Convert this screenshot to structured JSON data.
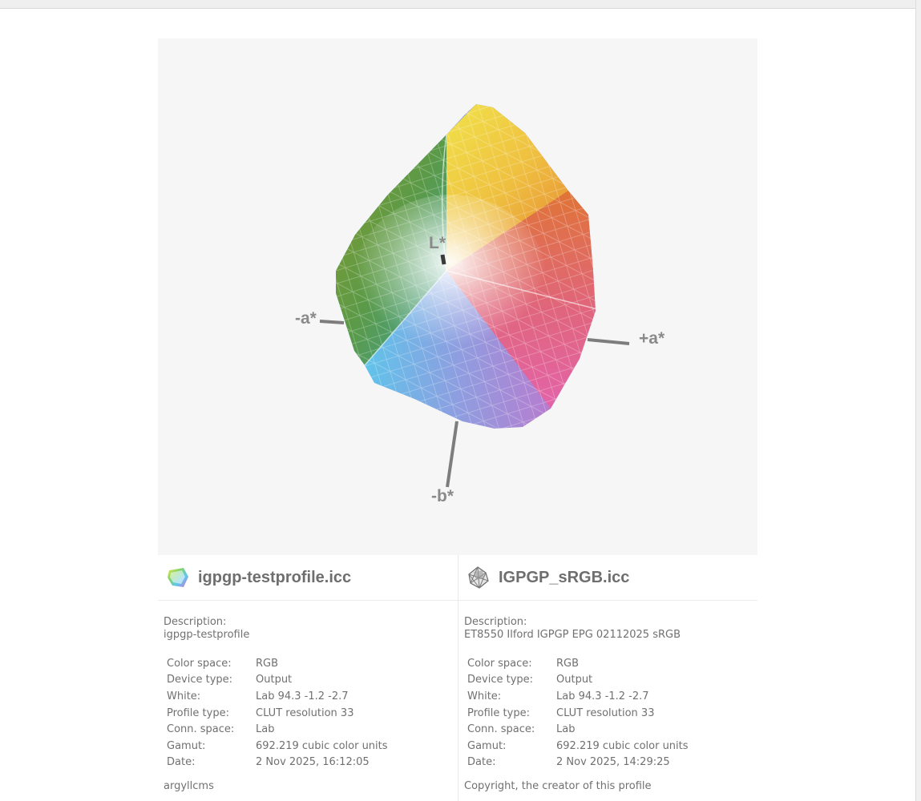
{
  "viewer": {
    "axes": {
      "l_label": "L*",
      "minus_a_label": "-a*",
      "plus_a_label": "+a*",
      "minus_b_label": "-b*"
    }
  },
  "profiles": [
    {
      "title": "igpgp-testprofile.icc",
      "icon": "gamut-cube-icon",
      "description_label": "Description:",
      "description": "igpgp-testprofile",
      "rows": [
        {
          "key": "Color space:",
          "value": "RGB"
        },
        {
          "key": "Device type:",
          "value": "Output"
        },
        {
          "key": "White:",
          "value": "Lab 94.3 -1.2 -2.7"
        },
        {
          "key": "Profile type:",
          "value": "CLUT resolution 33"
        },
        {
          "key": "Conn. space:",
          "value": "Lab"
        },
        {
          "key": "Gamut:",
          "value": "692.219 cubic color units"
        },
        {
          "key": "Date:",
          "value": "2 Nov 2025, 16:12:05"
        }
      ],
      "footer": "argyllcms"
    },
    {
      "title": "IGPGP_sRGB.icc",
      "icon": "wireframe-gamut-icon",
      "description_label": "Description:",
      "description": "ET8550 Ilford IGPGP EPG 02112025 sRGB",
      "rows": [
        {
          "key": "Color space:",
          "value": "RGB"
        },
        {
          "key": "Device type:",
          "value": "Output"
        },
        {
          "key": "White:",
          "value": "Lab 94.3 -1.2 -2.7"
        },
        {
          "key": "Profile type:",
          "value": "CLUT resolution 33"
        },
        {
          "key": "Conn. space:",
          "value": "Lab"
        },
        {
          "key": "Gamut:",
          "value": "692.219 cubic color units"
        },
        {
          "key": "Date:",
          "value": "2 Nov 2025, 14:29:25"
        }
      ],
      "footer": "Copyright, the creator of this profile"
    }
  ],
  "colors": {
    "viewer_bg": "#f6f6f7",
    "text": "#707070",
    "title": "#6e6e6e",
    "axis": "#808080"
  }
}
